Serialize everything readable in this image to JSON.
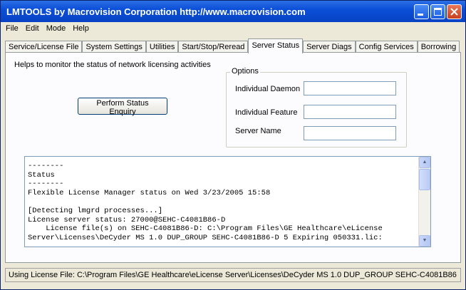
{
  "window": {
    "title": "LMTOOLS by Macrovision Corporation http://www.macrovision.com"
  },
  "menu": [
    "File",
    "Edit",
    "Mode",
    "Help"
  ],
  "tabs": [
    {
      "label": "Service/License File",
      "active": false
    },
    {
      "label": "System Settings",
      "active": false
    },
    {
      "label": "Utilities",
      "active": false
    },
    {
      "label": "Start/Stop/Reread",
      "active": false
    },
    {
      "label": "Server Status",
      "active": true
    },
    {
      "label": "Server Diags",
      "active": false
    },
    {
      "label": "Config Services",
      "active": false
    },
    {
      "label": "Borrowing",
      "active": false
    }
  ],
  "panel": {
    "description": "Helps to monitor the status of network licensing activities",
    "enquiry_button": "Perform Status Enquiry",
    "options": {
      "legend": "Options",
      "daemon_label": "Individual Daemon",
      "daemon_value": "",
      "feature_label": "Individual Feature",
      "feature_value": "",
      "server_label": "Server Name",
      "server_value": ""
    },
    "log_text": "--------\nStatus\n--------\nFlexible License Manager status on Wed 3/23/2005 15:58\n\n[Detecting lmgrd processes...]\nLicense server status: 27000@SEHC-C4081B86-D\n    License file(s) on SEHC-C4081B86-D: C:\\Program Files\\GE Healthcare\\eLicense\nServer\\Licenses\\DeCyder MS 1.0 DUP_GROUP SEHC-C4081B86-D 5 Expiring 050331.lic:"
  },
  "status_bar": "Using License File:  C:\\Program Files\\GE Healthcare\\eLicense Server\\Licenses\\DeCyder MS 1.0 DUP_GROUP SEHC-C4081B86",
  "icons": {
    "minimize": "minimize-icon",
    "maximize": "maximize-icon",
    "close": "close-icon",
    "scroll_up": "scroll-up-arrow-icon",
    "scroll_down": "scroll-down-arrow-icon"
  },
  "colors": {
    "titlebar": "#0b4fd8",
    "close_button": "#c8401e",
    "face": "#ece9d8"
  }
}
